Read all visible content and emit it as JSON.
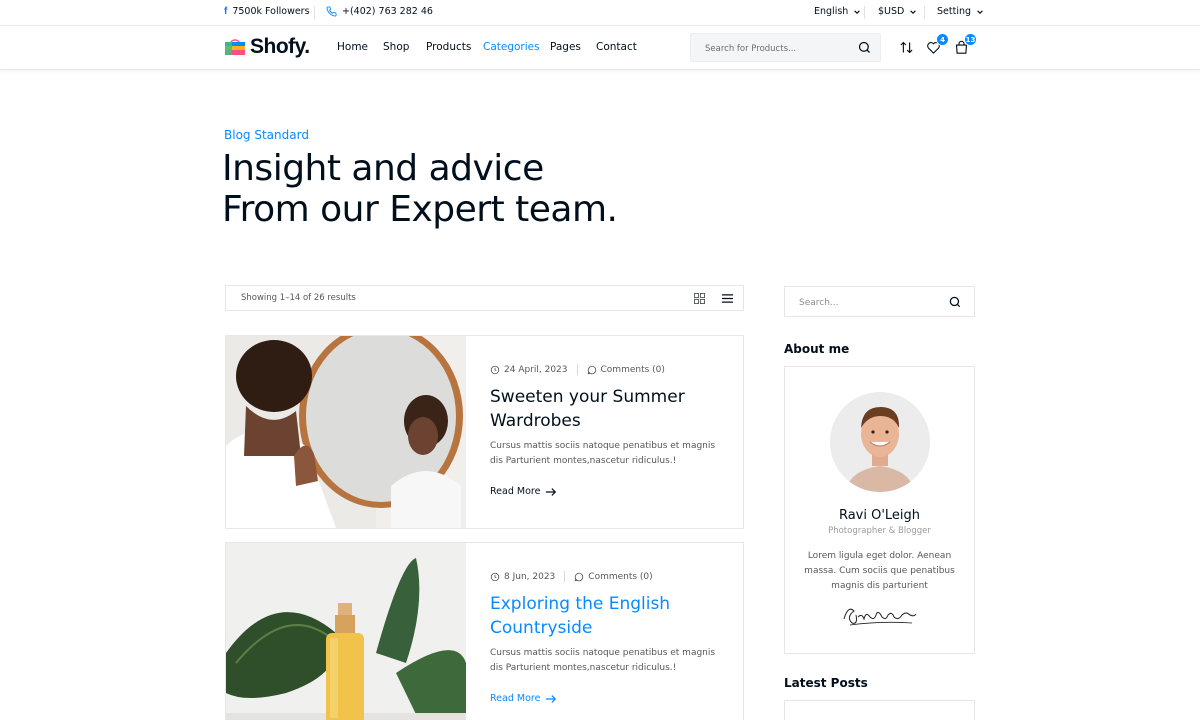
{
  "topbar": {
    "followers": "7500k Followers",
    "phone": "+(402) 763 282 46",
    "language": "English",
    "currency": "$USD",
    "setting": "Setting"
  },
  "header": {
    "logo": "Shofy.",
    "nav": [
      "Home",
      "Shop",
      "Products",
      "Categories",
      "Pages",
      "Contact"
    ],
    "active_nav": "Categories",
    "search_placeholder": "Search for Products...",
    "wishlist_count": "4",
    "cart_count": "13"
  },
  "hero": {
    "breadcrumb": "Blog Standard",
    "title_line1": "Insight and advice",
    "title_line2": "From our Expert team."
  },
  "results": {
    "text": "Showing 1–14 of 26 results"
  },
  "posts": [
    {
      "date": "24 April, 2023",
      "comments": "Comments (0)",
      "title": "Sweeten your Summer Wardrobes",
      "excerpt": "Cursus mattis sociis natoque penatibus et magnis dis Parturient montes,nascetur ridiculus.!",
      "more": "Read More"
    },
    {
      "date": "8 Jun, 2023",
      "comments": "Comments (0)",
      "title": "Exploring the English Countryside",
      "excerpt": "Cursus mattis sociis natoque penatibus et magnis dis Parturient montes,nascetur ridiculus.!",
      "more": "Read More"
    }
  ],
  "sidebar": {
    "search_placeholder": "Search...",
    "about_heading": "About me",
    "about_name": "Ravi O'Leigh",
    "about_role": "Photographer & Blogger",
    "about_bio": "Lorem ligula eget dolor. Aenean massa. Cum sociis que penatibus magnis dis parturient",
    "latest_heading": "Latest Posts"
  },
  "colors": {
    "accent": "#0989ff",
    "text": "#010f1c",
    "muted": "#55585b"
  }
}
